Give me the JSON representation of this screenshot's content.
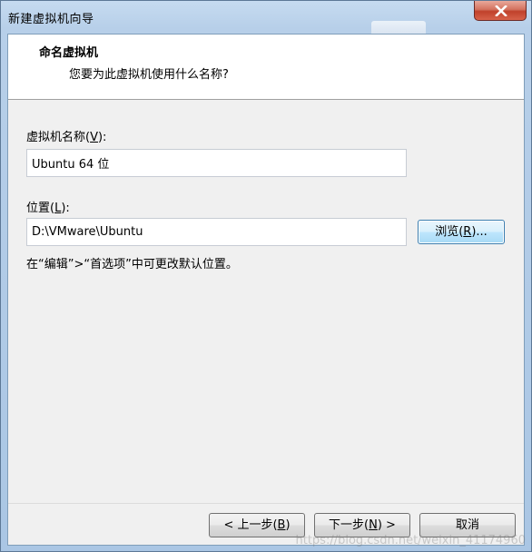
{
  "window": {
    "title": "新建虚拟机向导"
  },
  "header": {
    "title": "命名虚拟机",
    "subtitle": "您要为此虚拟机使用什么名称?"
  },
  "vm_name": {
    "label_pre": "虚拟机名称(",
    "label_key": "V",
    "label_post": "):",
    "value": "Ubuntu 64 位"
  },
  "location": {
    "label_pre": "位置(",
    "label_key": "L",
    "label_post": "):",
    "value": "D:\\VMware\\Ubuntu",
    "browse_pre": "浏览(",
    "browse_key": "R",
    "browse_post": ")..."
  },
  "hint": "在“编辑”>“首选项”中可更改默认位置。",
  "footer": {
    "back_pre": "< 上一步(",
    "back_key": "B",
    "back_post": ")",
    "next_pre": "下一步(",
    "next_key": "N",
    "next_post": ") >",
    "cancel": "取消"
  },
  "watermark": "https://blog.csdn.net/weixin_41174960"
}
